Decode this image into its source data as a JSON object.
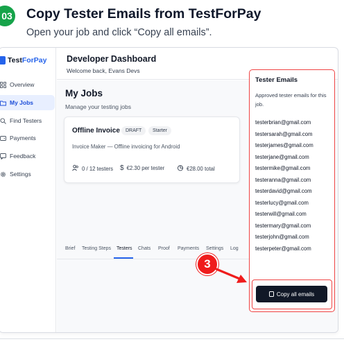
{
  "header": {
    "step_number": "03",
    "title": "Copy Tester Emails from TestForPay",
    "subtitle": "Open your job and click “Copy all emails”."
  },
  "sidebar": {
    "brand_prefix": "Test",
    "brand_accent": "ForPay",
    "items": [
      {
        "label": "Overview",
        "icon": "grid-icon"
      },
      {
        "label": "My Jobs",
        "icon": "folder-icon",
        "active": true
      },
      {
        "label": "Find Testers",
        "icon": "search-icon"
      },
      {
        "label": "Payments",
        "icon": "wallet-icon"
      },
      {
        "label": "Feedback",
        "icon": "comment-icon"
      },
      {
        "label": "Settings",
        "icon": "gear-icon"
      }
    ]
  },
  "main": {
    "title": "Developer Dashboard",
    "welcome": "Welcome back, Evans Devs",
    "jobs_title": "My Jobs",
    "jobs_subtitle": "Manage your testing jobs"
  },
  "job": {
    "name": "Offline Invoice",
    "status": "DRAFT",
    "plan": "Starter",
    "description": "Invoice Maker — Offline invoicing for Android",
    "testers": "0 / 12 testers",
    "price": "€2.30 per tester",
    "total": "€28.00 total"
  },
  "tabs": [
    "Brief",
    "Testing Steps",
    "Testers",
    "Chats",
    "Proof",
    "Payments",
    "Settings",
    "Log"
  ],
  "active_tab": "Testers",
  "emails_panel": {
    "title": "Tester Emails",
    "description": "Approved tester emails for this job.",
    "emails": [
      "testerbrian@gmail.com",
      "testersarah@gmail.com",
      "testerjames@gmail.com",
      "testerjane@gmail.com",
      "testermike@gmail.com",
      "testeranna@gmail.com",
      "testerdavid@gmail.com",
      "testerlucy@gmail.com",
      "testerwill@gmail.com",
      "testermary@gmail.com",
      "testerjohn@gmail.com",
      "testerpeter@gmail.com"
    ],
    "copy_button": "Copy all emails"
  },
  "annotation": {
    "step": "3"
  },
  "colors": {
    "step_badge": "#16a34a",
    "annotation_red": "#ef1c1c",
    "accent_blue": "#2563eb",
    "button_dark": "#111827"
  }
}
